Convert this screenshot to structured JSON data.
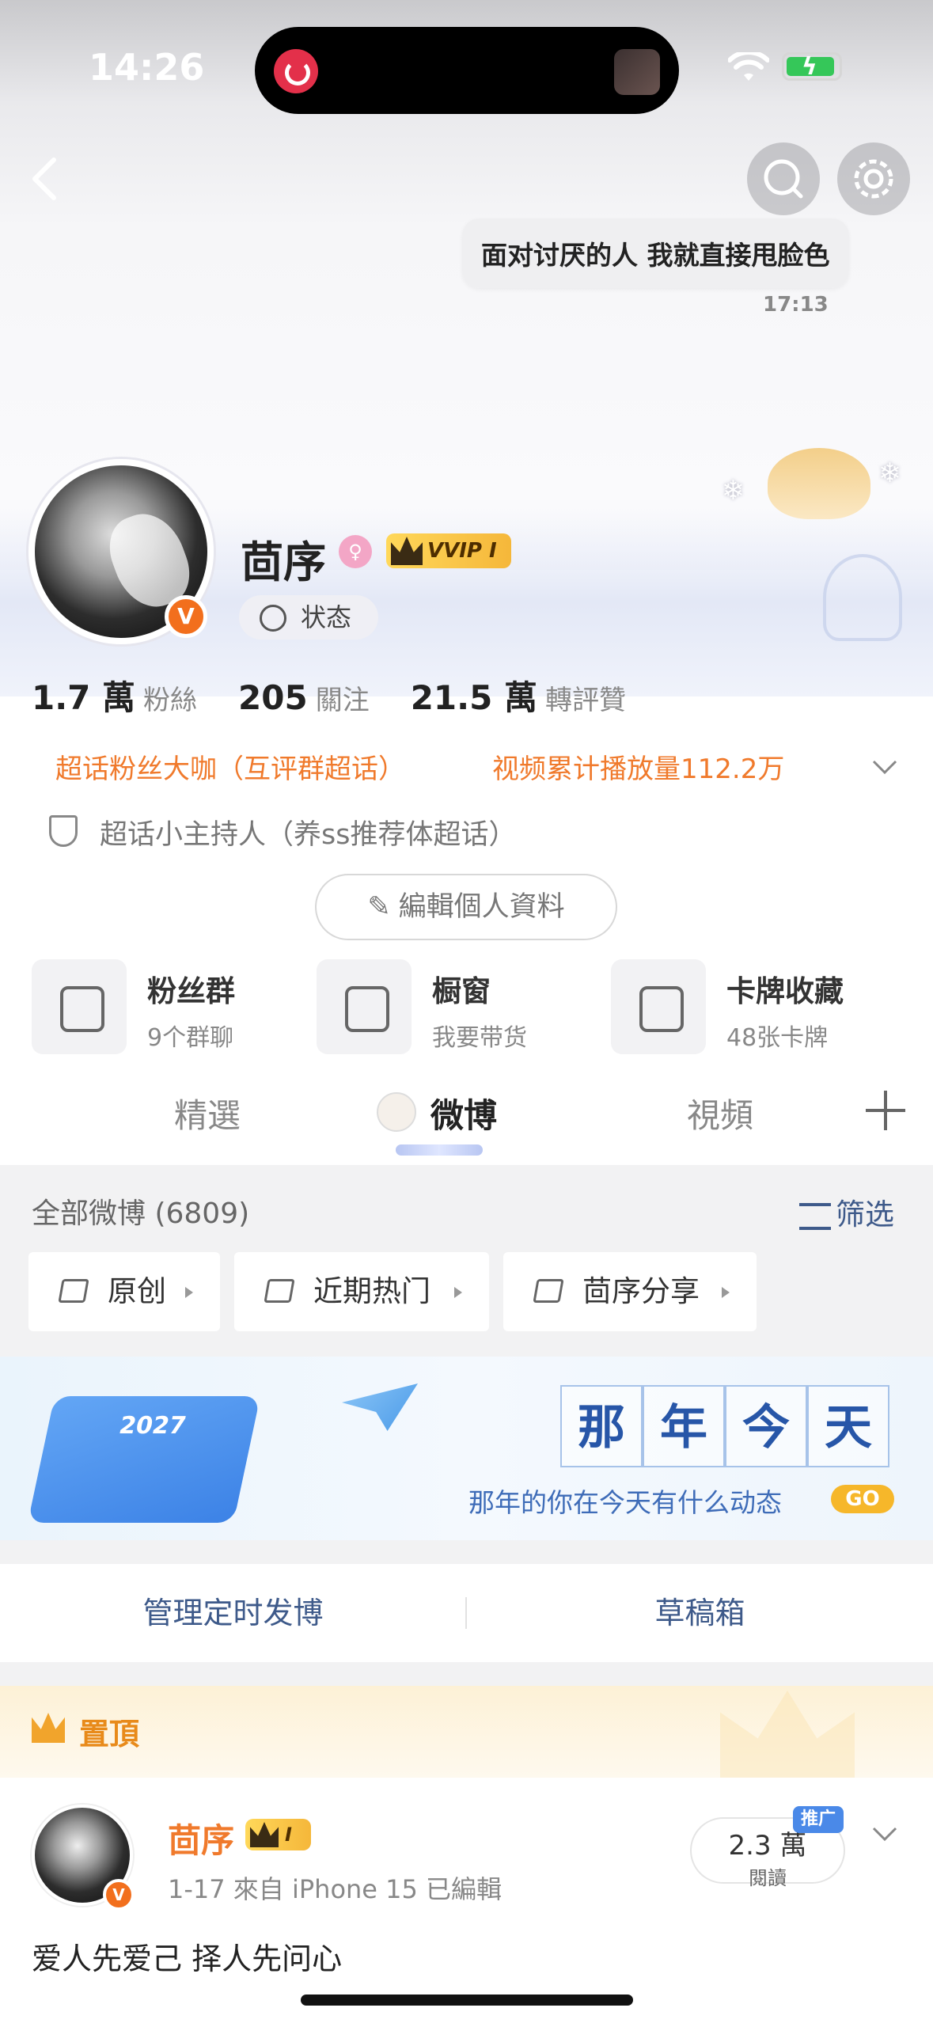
{
  "status_bar": {
    "time": "14:26"
  },
  "header": {
    "back_icon": "chevron-left-icon",
    "search_icon": "search-icon",
    "settings_icon": "gear-icon",
    "bubble_text": "面对讨厌的人 我就直接甩脸色",
    "bubble_time": "17:13"
  },
  "profile": {
    "name": "茴序",
    "verified_badge": "V",
    "vip_label": "VVIP I",
    "status_label": "状态",
    "stats": [
      {
        "value": "1.7 萬",
        "label": "粉絲"
      },
      {
        "value": "205",
        "label": "關注"
      },
      {
        "value": "21.5 萬",
        "label": "轉評贊"
      }
    ],
    "tags": [
      "超话粉丝大咖（互评群超话）",
      "视频累计播放量112.2万"
    ],
    "honor": "超话小主持人（养ss推荐体超话）",
    "edit_label": "編輯個人資料"
  },
  "features": [
    {
      "title": "粉丝群",
      "subtitle": "9个群聊",
      "icon": "people-icon"
    },
    {
      "title": "橱窗",
      "subtitle": "我要带货",
      "icon": "shopping-bag-icon"
    },
    {
      "title": "卡牌收藏",
      "subtitle": "48张卡牌",
      "icon": "card-icon"
    }
  ],
  "tabs": [
    {
      "label": "精選",
      "active": false
    },
    {
      "label": "微博",
      "active": true
    },
    {
      "label": "視頻",
      "active": false
    }
  ],
  "feed": {
    "all_count": "全部微博 (6809)",
    "filter_label": "筛选",
    "chips": [
      "原创",
      "近期热门",
      "茴序分享"
    ]
  },
  "banner": {
    "year": "2027",
    "chars": [
      "那",
      "年",
      "今",
      "天"
    ],
    "subtitle": "那年的你在今天有什么动态",
    "go_label": "GO"
  },
  "actions": {
    "scheduled": "管理定时发博",
    "drafts": "草稿箱"
  },
  "pinned": {
    "label": "置頂",
    "author": "茴序",
    "vip_label": "I",
    "meta": "1-17  來自 iPhone 15  已編輯",
    "reads_value": "2.3 萬",
    "reads_label": "閱讀",
    "promo_label": "推广",
    "text": "爱人先爱己 择人先问心"
  },
  "colors": {
    "accent_orange": "#f07a2c",
    "link_blue": "#3e5a8a",
    "vip_gold": "#f5b73a",
    "verified_orange": "#f26f1d"
  }
}
